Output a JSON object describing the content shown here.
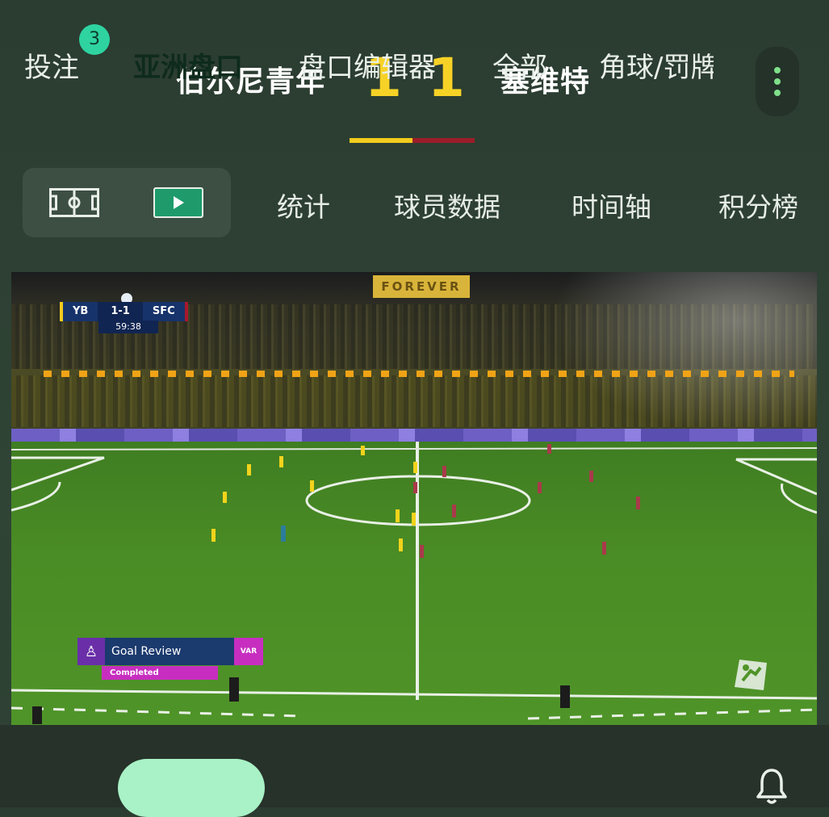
{
  "match": {
    "home_team": "伯尔尼青年",
    "away_team": "塞维特",
    "home_score": "1",
    "away_score": "1",
    "home_color": "#f2cb1e",
    "away_color": "#9a1d2a"
  },
  "header": {
    "menu_icon": "more-vertical-icon"
  },
  "tabs": {
    "view_icons": [
      "pitch-icon",
      "video-play-icon"
    ],
    "items": [
      {
        "label": "统计"
      },
      {
        "label": "球员数据"
      },
      {
        "label": "时间轴"
      },
      {
        "label": "积分榜"
      }
    ]
  },
  "video": {
    "banner": "FOREVER",
    "scorebug": {
      "home": "YB",
      "score": "1-1",
      "away": "SFC",
      "clock": "59:38"
    },
    "overlay": {
      "title": "Goal Review",
      "var_label": "VAR",
      "status": "Completed"
    }
  },
  "bottom_nav": {
    "items": [
      {
        "label": "投注",
        "badge": "3"
      },
      {
        "label": "亚洲盘口",
        "active": true
      },
      {
        "label": "盘口编辑器"
      },
      {
        "label": "全部"
      },
      {
        "label": "角球/罚牌"
      }
    ],
    "bell_icon": "bell-icon",
    "accent": "#a9f1c6"
  }
}
